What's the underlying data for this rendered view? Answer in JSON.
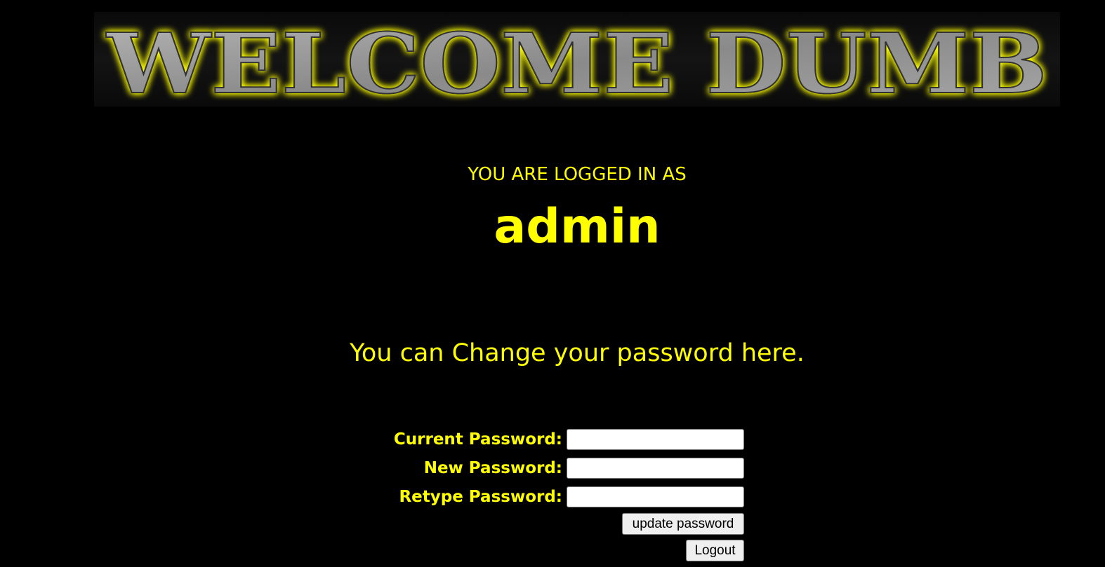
{
  "banner": {
    "title": "WELCOME DUMB",
    "glow_color": "#FFFF00",
    "text_color": "#9a9a9a"
  },
  "session": {
    "logged_in_label": "YOU ARE LOGGED IN AS",
    "username": "admin"
  },
  "change_password": {
    "heading": "You can Change your password here.",
    "current_label": "Current Password:",
    "current_value": "",
    "new_label": "New Password:",
    "new_value": "",
    "retype_label": "Retype Password:",
    "retype_value": "",
    "update_button": "update password",
    "logout_button": "Logout"
  },
  "colors": {
    "background": "#000000",
    "accent": "#FFFF00"
  }
}
